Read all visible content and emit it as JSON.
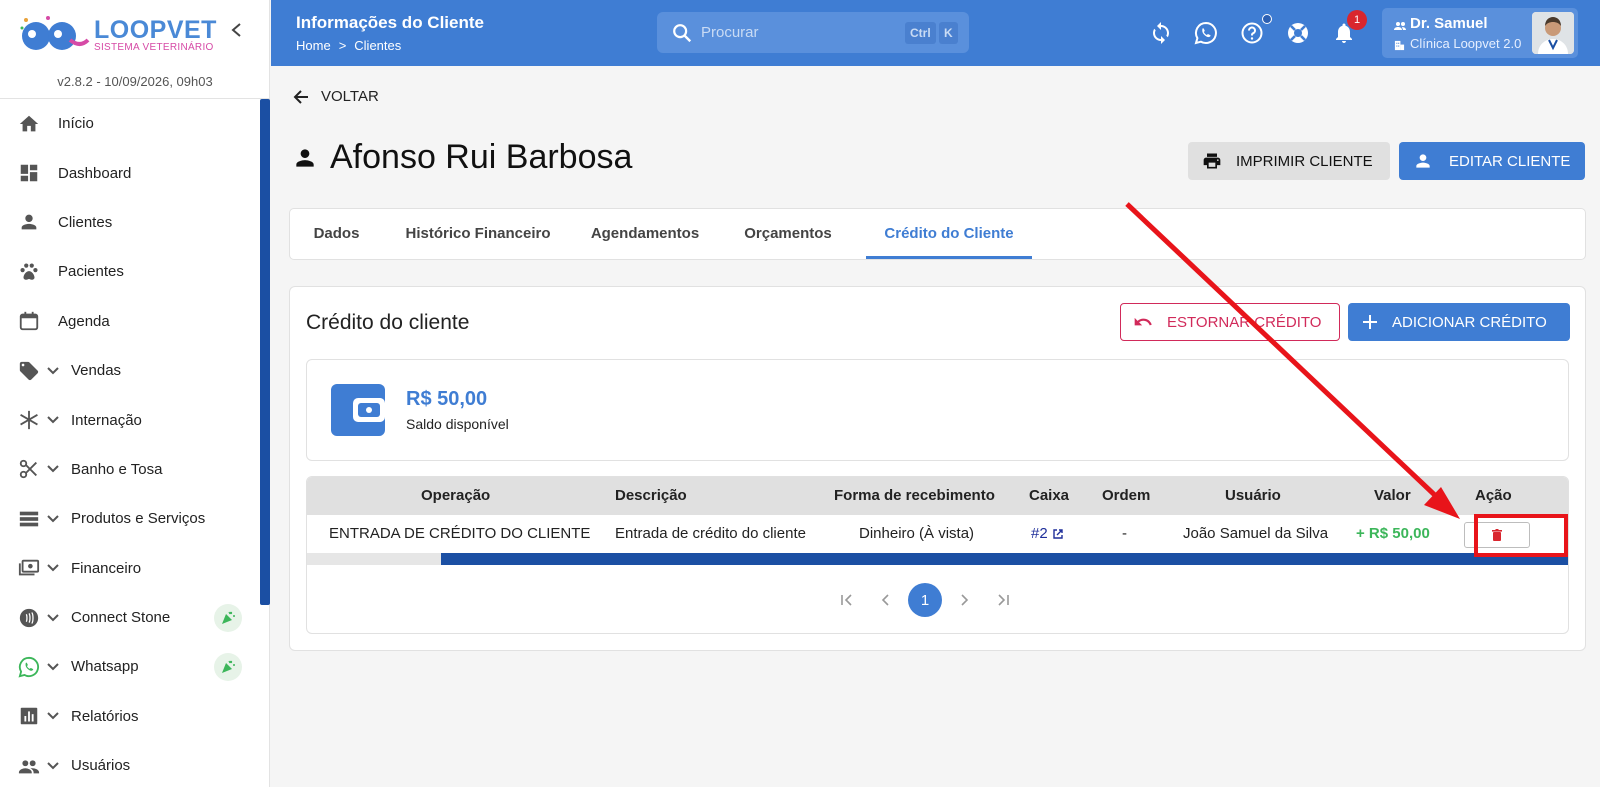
{
  "app": {
    "logo_text": "LOOPVET",
    "logo_subtitle": "SISTEMA VETERINÁRIO",
    "version": "v2.8.2 - 10/09/2026, 09h03"
  },
  "sidebar": {
    "items": [
      {
        "label": "Início",
        "icon": "home-icon"
      },
      {
        "label": "Dashboard",
        "icon": "dashboard-icon"
      },
      {
        "label": "Clientes",
        "icon": "person-icon"
      },
      {
        "label": "Pacientes",
        "icon": "paw-icon"
      },
      {
        "label": "Agenda",
        "icon": "calendar-icon"
      },
      {
        "label": "Vendas",
        "icon": "tag-icon",
        "expandable": true
      },
      {
        "label": "Internação",
        "icon": "asterisk-icon",
        "expandable": true
      },
      {
        "label": "Banho e Tosa",
        "icon": "scissors-icon",
        "expandable": true
      },
      {
        "label": "Produtos e Serviços",
        "icon": "list-icon",
        "expandable": true
      },
      {
        "label": "Financeiro",
        "icon": "money-icon",
        "expandable": true
      },
      {
        "label": "Connect Stone",
        "icon": "contactless-icon",
        "expandable": true,
        "badge": "party-icon"
      },
      {
        "label": "Whatsapp",
        "icon": "whatsapp-icon",
        "expandable": true,
        "badge": "party-icon"
      },
      {
        "label": "Relatórios",
        "icon": "chart-icon",
        "expandable": true
      },
      {
        "label": "Usuários",
        "icon": "users-icon",
        "expandable": true
      }
    ]
  },
  "topbar": {
    "title": "Informações do Cliente",
    "breadcrumb": [
      "Home",
      ">",
      "Clientes"
    ],
    "search_placeholder": "Procurar",
    "shortcut_keys": [
      "Ctrl",
      "K"
    ],
    "notification_count": "1",
    "user_name": "Dr. Samuel",
    "user_clinic": "Clínica Loopvet 2.0"
  },
  "page": {
    "back_label": "VOLTAR",
    "client_name": "Afonso Rui Barbosa",
    "print_label": "IMPRIMIR CLIENTE",
    "edit_label": "EDITAR CLIENTE"
  },
  "tabs": [
    {
      "label": "Dados"
    },
    {
      "label": "Histórico Financeiro"
    },
    {
      "label": "Agendamentos"
    },
    {
      "label": "Orçamentos"
    },
    {
      "label": "Crédito do Cliente",
      "active": true
    }
  ],
  "credit": {
    "title": "Crédito do cliente",
    "refund_label": "ESTORNAR CRÉDITO",
    "add_label": "ADICIONAR CRÉDITO",
    "balance": "R$ 50,00",
    "balance_label": "Saldo disponível"
  },
  "table": {
    "headers": [
      "Operação",
      "Descrição",
      "Forma de recebimento",
      "Caixa",
      "Ordem",
      "Usuário",
      "Valor",
      "Ação"
    ],
    "rows": [
      {
        "operacao": "ENTRADA DE CRÉDITO DO CLIENTE",
        "descricao": "Entrada de crédito do cliente",
        "forma": "Dinheiro (À vista)",
        "caixa": "#2",
        "ordem": "-",
        "usuario": "João Samuel da Silva",
        "valor": "+ R$ 50,00"
      }
    ]
  },
  "pagination": {
    "current_page": "1"
  },
  "colors": {
    "primary": "#3f7dd3",
    "danger": "#d12a5a",
    "success": "#3cb65a",
    "annotation": "#e8141a"
  }
}
